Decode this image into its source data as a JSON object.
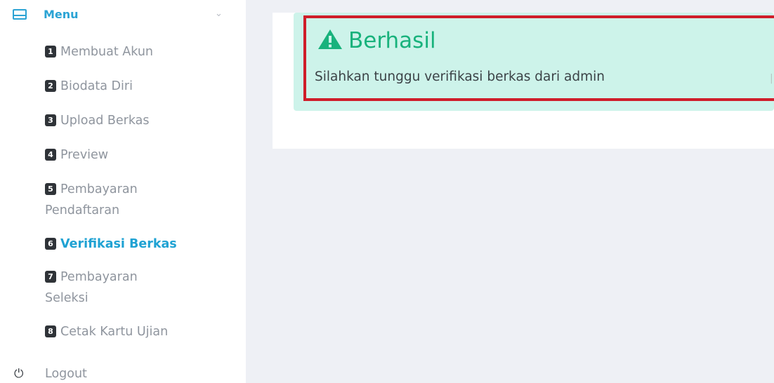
{
  "sidebar": {
    "menu": {
      "label": "Menu"
    },
    "steps": [
      {
        "num": "1",
        "label": "Membuat Akun",
        "label2": ""
      },
      {
        "num": "2",
        "label": "Biodata Diri",
        "label2": ""
      },
      {
        "num": "3",
        "label": "Upload Berkas",
        "label2": ""
      },
      {
        "num": "4",
        "label": "Preview",
        "label2": ""
      },
      {
        "num": "5",
        "label": "Pembayaran",
        "label2": "Pendaftaran"
      },
      {
        "num": "6",
        "label": "Verifikasi Berkas",
        "label2": "",
        "active": true
      },
      {
        "num": "7",
        "label": "Pembayaran",
        "label2": "Seleksi"
      },
      {
        "num": "8",
        "label": "Cetak Kartu Ujian",
        "label2": ""
      }
    ],
    "logout": {
      "label": "Logout"
    }
  },
  "alert": {
    "title": "Berhasil",
    "message": "Silahkan tunggu verifikasi berkas dari admin",
    "icon": "warning-triangle-icon"
  },
  "colors": {
    "accent": "#2ba3d4",
    "alert_bg": "#cdf3ea",
    "alert_title": "#18b27c",
    "highlight": "#cf1d2a"
  }
}
